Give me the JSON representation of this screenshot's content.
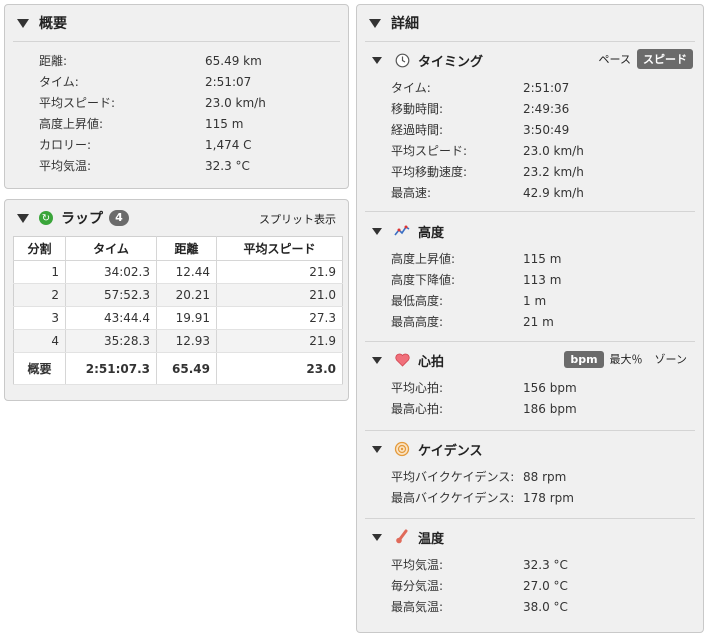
{
  "overview": {
    "title": "概要",
    "rows": [
      {
        "label": "距離:",
        "value": "65.49 km"
      },
      {
        "label": "タイム:",
        "value": "2:51:07"
      },
      {
        "label": "平均スピード:",
        "value": "23.0 km/h"
      },
      {
        "label": "高度上昇値:",
        "value": "115 m"
      },
      {
        "label": "カロリー:",
        "value": "1,474 C"
      },
      {
        "label": "平均気温:",
        "value": "32.3 °C"
      }
    ]
  },
  "laps": {
    "title": "ラップ",
    "count": "4",
    "split_link": "スプリット表示",
    "columns": [
      "分割",
      "タイム",
      "距離",
      "平均スピード"
    ],
    "rows": [
      [
        "1",
        "34:02.3",
        "12.44",
        "21.9"
      ],
      [
        "2",
        "57:52.3",
        "20.21",
        "21.0"
      ],
      [
        "3",
        "43:44.4",
        "19.91",
        "27.3"
      ],
      [
        "4",
        "35:28.3",
        "12.93",
        "21.9"
      ]
    ],
    "total": [
      "概要",
      "2:51:07.3",
      "65.49",
      "23.0"
    ]
  },
  "details": {
    "title": "詳細",
    "timing": {
      "title": "タイミング",
      "toggle_pace": "ペース",
      "toggle_speed": "スピード",
      "rows": [
        {
          "label": "タイム:",
          "value": "2:51:07"
        },
        {
          "label": "移動時間:",
          "value": "2:49:36"
        },
        {
          "label": "経過時間:",
          "value": "3:50:49"
        },
        {
          "label": "平均スピード:",
          "value": "23.0 km/h"
        },
        {
          "label": "平均移動速度:",
          "value": "23.2 km/h"
        },
        {
          "label": "最高速:",
          "value": "42.9 km/h"
        }
      ]
    },
    "elevation": {
      "title": "高度",
      "rows": [
        {
          "label": "高度上昇値:",
          "value": "115 m"
        },
        {
          "label": "高度下降値:",
          "value": "113 m"
        },
        {
          "label": "最低高度:",
          "value": "1 m"
        },
        {
          "label": "最高高度:",
          "value": "21 m"
        }
      ]
    },
    "heart_rate": {
      "title": "心拍",
      "toggle_bpm": "bpm",
      "toggle_max": "最大％",
      "toggle_zone": "ゾーン",
      "rows": [
        {
          "label": "平均心拍:",
          "value": "156 bpm"
        },
        {
          "label": "最高心拍:",
          "value": "186 bpm"
        }
      ]
    },
    "cadence": {
      "title": "ケイデンス",
      "rows": [
        {
          "label": "平均バイクケイデンス:",
          "value": "88 rpm"
        },
        {
          "label": "最高バイクケイデンス:",
          "value": "178 rpm"
        }
      ]
    },
    "temperature": {
      "title": "温度",
      "rows": [
        {
          "label": "平均気温:",
          "value": "32.3 °C"
        },
        {
          "label": "毎分気温:",
          "value": "27.0 °C"
        },
        {
          "label": "最高気温:",
          "value": "38.0 °C"
        }
      ]
    }
  }
}
